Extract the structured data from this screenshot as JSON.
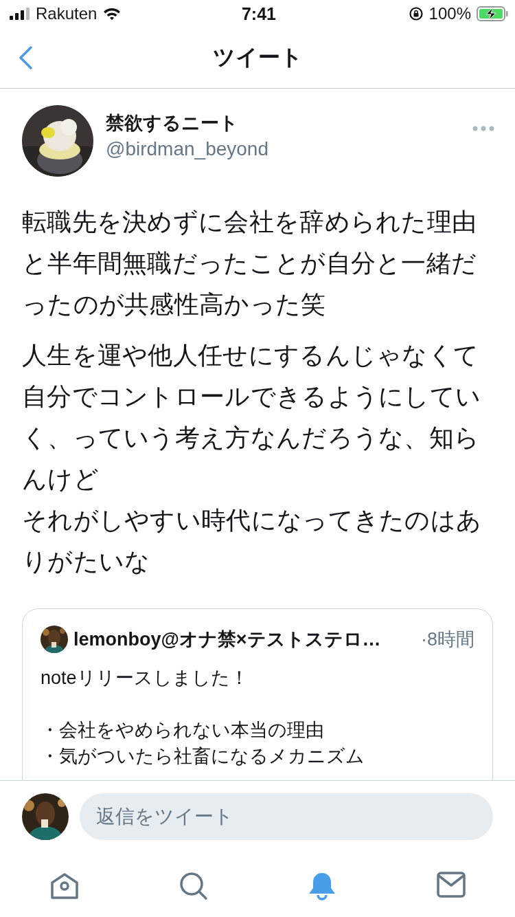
{
  "status_bar": {
    "carrier": "Rakuten",
    "time": "7:41",
    "battery": "100%"
  },
  "nav": {
    "title": "ツイート"
  },
  "tweet": {
    "name": "禁欲するニート",
    "handle": "@birdman_beyond",
    "paragraphs": [
      [
        "転職先を決めずに会社を辞められた理由と半年間無職だったことが自分と一緒だったのが共感性高かった笑"
      ],
      [
        "人生を運や他人任せにするんじゃなくて自分でコントロールできるようにしていく、っていう考え方なんだろうな、知らんけど",
        "それがしやすい時代になってきたのはありがたいな"
      ]
    ],
    "quote": {
      "name": "lemonboy@オナ禁×テストステロ…",
      "time": "·8時間",
      "blocks": [
        [
          "noteリリースしました！"
        ],
        [
          "・会社をやめられない本当の理由",
          "・気がついたら社畜になるメカニズム"
        ]
      ]
    }
  },
  "reply": {
    "placeholder": "返信をツイート"
  },
  "tabs": [
    {
      "kind": "home",
      "selected": false
    },
    {
      "kind": "search",
      "selected": false
    },
    {
      "kind": "notifications",
      "selected": true
    },
    {
      "kind": "messages",
      "selected": false
    }
  ]
}
